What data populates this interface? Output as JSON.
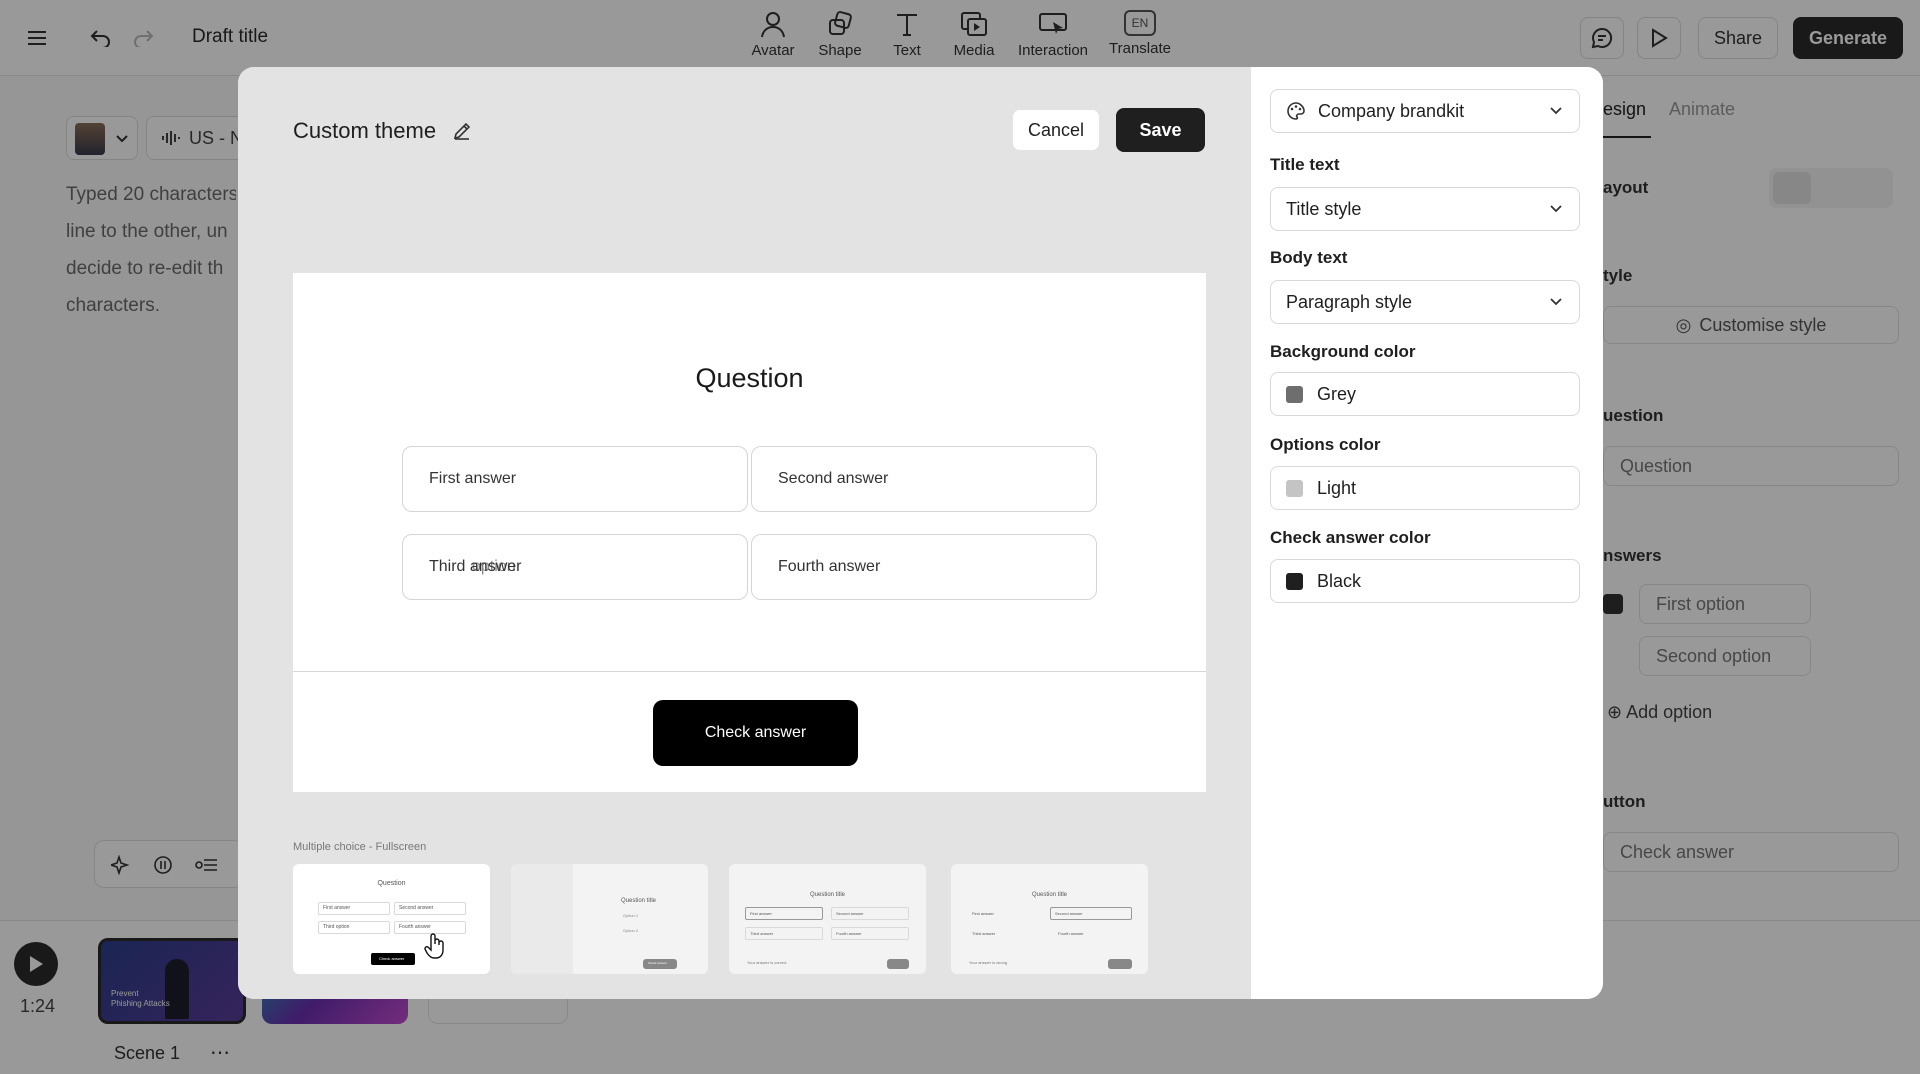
{
  "topbar": {
    "draft_title": "Draft title",
    "tools": [
      {
        "label": "Avatar",
        "icon": "avatar-icon"
      },
      {
        "label": "Shape",
        "icon": "shape-icon"
      },
      {
        "label": "Text",
        "icon": "text-icon"
      },
      {
        "label": "Media",
        "icon": "media-icon"
      },
      {
        "label": "Interaction",
        "icon": "interaction-icon"
      },
      {
        "label": "Translate",
        "icon": "translate-icon",
        "badge": "EN"
      }
    ],
    "share_label": "Share",
    "generate_label": "Generate"
  },
  "editor": {
    "voice_label": "US - N",
    "script_lines": [
      "Typed 20 characters",
      "line to the other, un",
      "decide to re-edit th",
      "characters."
    ]
  },
  "timeline": {
    "timecode": "1:24",
    "scene_label": "Scene 1",
    "scene1_thumb_text": "Prevent Phishing Attacks"
  },
  "right_panel": {
    "tabs": [
      "esign",
      "Animate"
    ],
    "layout_label": "ayout",
    "style_label": "tyle",
    "customise_label": "Customise style",
    "question_label": "uestion",
    "question_value": "Question",
    "answers_label": "nswers",
    "option1": "First option",
    "option2": "Second option",
    "add_option": "Add option",
    "button_label": "utton",
    "button_value": "Check answer"
  },
  "modal": {
    "title": "Custom theme",
    "cancel_label": "Cancel",
    "save_label": "Save",
    "preview": {
      "question": "Question",
      "answers": [
        "First answer",
        "Second answer",
        "Third answer",
        "Fourth answer"
      ],
      "third_overlay": "option",
      "check_label": "Check answer"
    },
    "layout_name": "Multiple choice - Fullscreen",
    "thumbnails": [
      {
        "title": "Question",
        "answers": [
          "First answer",
          "Second answer",
          "Third option",
          "Fourth answer"
        ],
        "button": "Check answer"
      },
      {
        "title": "Question title",
        "answers": [
          "Option 1",
          "Option 2"
        ],
        "button": "Check answer"
      },
      {
        "title": "Question title",
        "answers": [
          "First answer",
          "Second answer",
          "Third answer",
          "Fourth answer"
        ],
        "feedback": "Your answer is correct"
      },
      {
        "title": "Question title",
        "answers": [
          "First answer",
          "Second answer",
          "Third answer",
          "Fourth answer"
        ],
        "feedback": "Your answer is wrong"
      }
    ],
    "sidebar": {
      "brandkit": "Company brandkit",
      "title_text_label": "Title text",
      "title_text_value": "Title style",
      "body_text_label": "Body text",
      "body_text_value": "Paragraph style",
      "bg_color_label": "Background color",
      "bg_color_value": "Grey",
      "bg_color_hex": "#6e6e6e",
      "options_color_label": "Options color",
      "options_color_value": "Light",
      "options_color_hex": "#c4c4c4",
      "check_color_label": "Check answer color",
      "check_color_value": "Black",
      "check_color_hex": "#1f1f1f"
    }
  }
}
